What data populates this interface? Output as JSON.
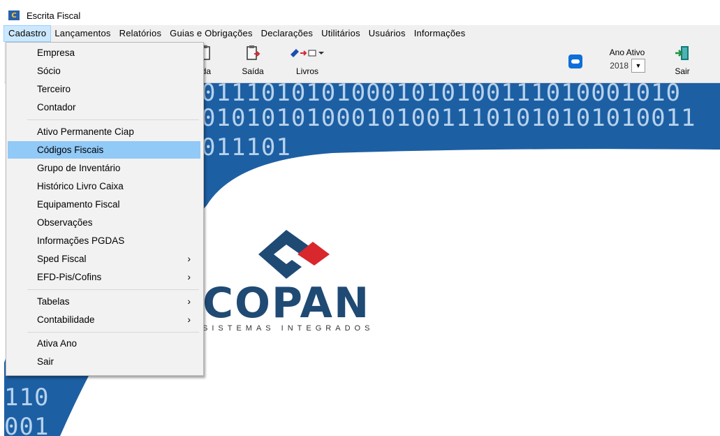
{
  "window": {
    "title": "Escrita Fiscal",
    "icon": "app-logo-icon"
  },
  "menubar": [
    "Cadastro",
    "Lançamentos",
    "Relatórios",
    "Guias e Obrigações",
    "Declarações",
    "Utilitários",
    "Usuários",
    "Informações"
  ],
  "toolbar": {
    "entrada_label": "ada",
    "saida_label": "Saída",
    "livros_label": "Livros",
    "ano_ativo_label": "Ano Ativo",
    "ano_ativo_value": "2018",
    "sair_label": "Sair"
  },
  "dropdown": {
    "items": [
      {
        "label": "Empresa",
        "submenu": false
      },
      {
        "label": "Sócio",
        "submenu": false
      },
      {
        "label": "Terceiro",
        "submenu": false
      },
      {
        "label": "Contador",
        "submenu": false
      },
      {
        "label": "Ativo Permanente  Ciap",
        "submenu": false
      },
      {
        "label": "Códigos Fiscais",
        "submenu": false,
        "highlighted": true
      },
      {
        "label": "Grupo de Inventário",
        "submenu": false
      },
      {
        "label": "Histórico Livro Caixa",
        "submenu": false
      },
      {
        "label": "Equipamento Fiscal",
        "submenu": false
      },
      {
        "label": "Observações",
        "submenu": false
      },
      {
        "label": "Informações PGDAS",
        "submenu": false
      },
      {
        "label": "Sped Fiscal",
        "submenu": true
      },
      {
        "label": "EFD-Pis/Cofins",
        "submenu": true
      },
      {
        "label": "Tabelas",
        "submenu": true
      },
      {
        "label": "Contabilidade",
        "submenu": true
      },
      {
        "label": "Ativa Ano",
        "submenu": false
      },
      {
        "label": "Sair",
        "submenu": false
      }
    ]
  },
  "background_text": {
    "row1": "01110101010001010100111010001010",
    "row2": "010101010001010011101010101010011",
    "row3": "011101",
    "row4": "110",
    "row5": "001"
  },
  "logo": {
    "main": "COPAN",
    "sub": "SISTEMAS INTEGRADOS"
  },
  "colors": {
    "banner": "#1d5fa3",
    "logo_blue": "#1f4a74",
    "logo_red": "#d9272e",
    "highlight": "#91c9f7"
  }
}
